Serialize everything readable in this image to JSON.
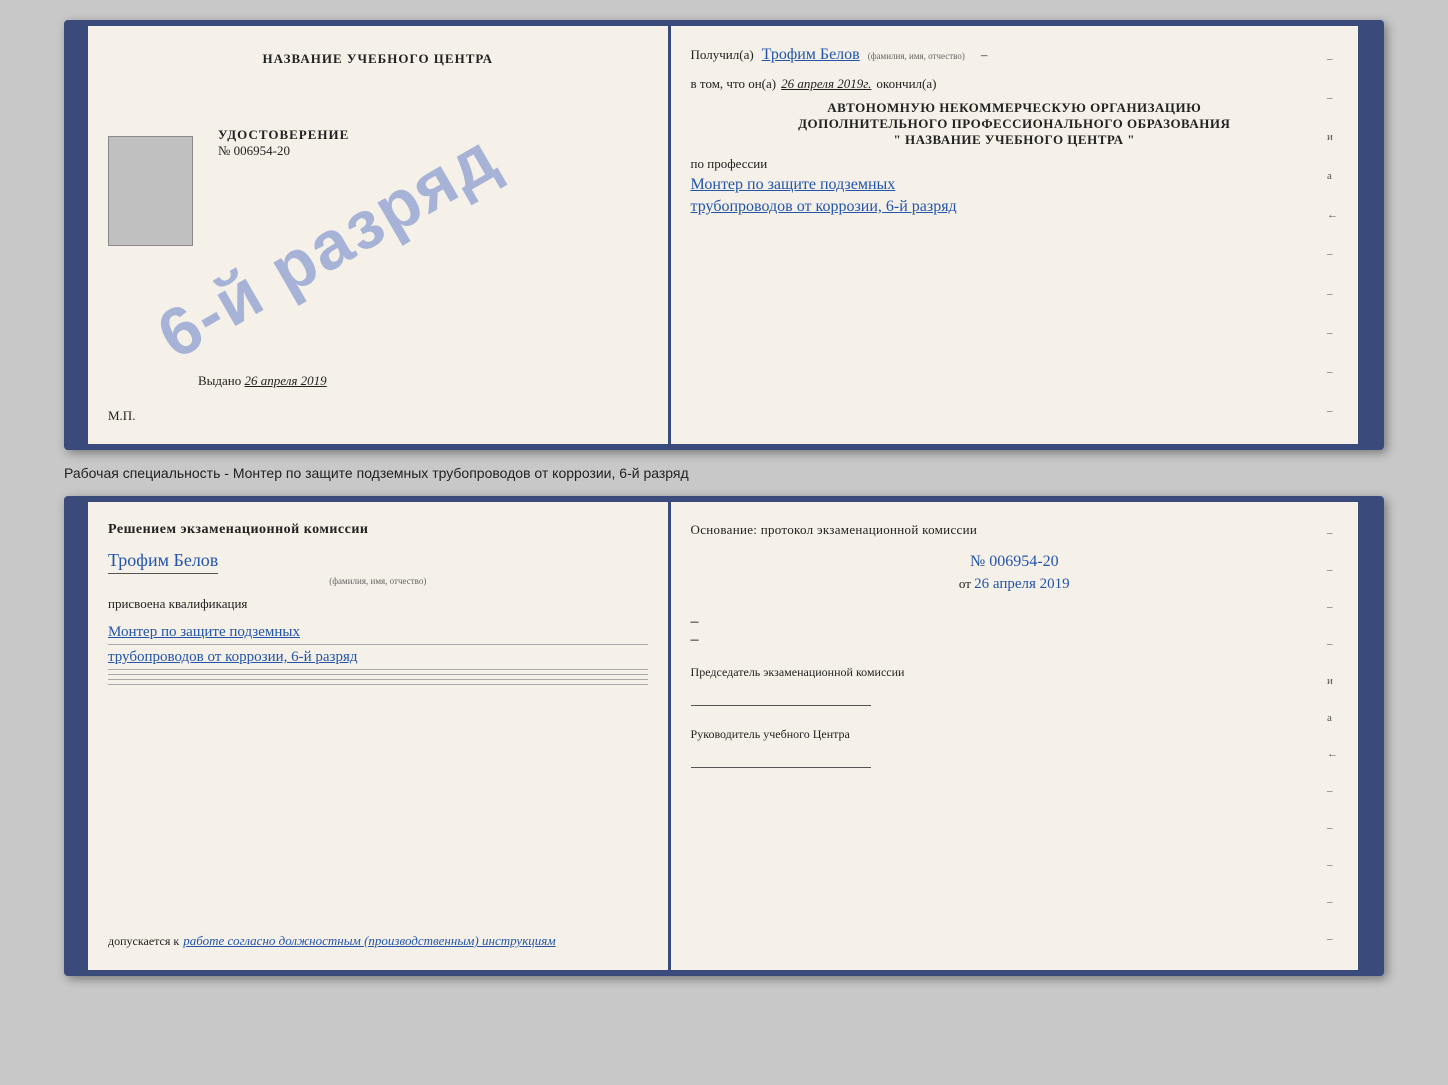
{
  "doc1": {
    "left": {
      "title": "НАЗВАНИЕ УЧЕБНОГО ЦЕНТРА",
      "udostoverenie_label": "УДОСТОВЕРЕНИЕ",
      "udostoverenie_number": "№ 006954-20",
      "vydano_label": "Выдано",
      "vydano_date": "26 апреля 2019",
      "mp": "М.П.",
      "stamp_text": "6-й разряд"
    },
    "right": {
      "received_label": "Получил(а)",
      "received_name": "Трофим Белов",
      "received_subtitle": "(фамилия, имя, отчество)",
      "dash1": "–",
      "vtom_label": "в том, что он(а)",
      "vtom_date": "26 апреля 2019г.",
      "okonchil": "окончил(а)",
      "org_line1": "АВТОНОМНУЮ НЕКОММЕРЧЕСКУЮ ОРГАНИЗАЦИЮ",
      "org_line2": "ДОПОЛНИТЕЛЬНОГО ПРОФЕССИОНАЛЬНОГО ОБРАЗОВАНИЯ",
      "org_line3": "\"  НАЗВАНИЕ УЧЕБНОГО ЦЕНТРА  \"",
      "po_professii": "по профессии",
      "profession_line1": "Монтер по защите подземных",
      "profession_line2": "трубопроводов от коррозии, 6-й разряд",
      "margin_letters": [
        "–",
        "–",
        "и",
        "а",
        "←",
        "–",
        "–",
        "–",
        "–",
        "–"
      ]
    }
  },
  "middle_text": "Рабочая специальность - Монтер по защите подземных трубопроводов от коррозии, 6-й разряд",
  "doc2": {
    "left": {
      "section_title": "Решением экзаменационной комиссии",
      "name": "Трофим Белов",
      "name_subtitle": "(фамилия, имя, отчество)",
      "prisvoena": "присвоена квалификация",
      "qualification_line1": "Монтер по защите подземных",
      "qualification_line2": "трубопроводов от коррозии, 6-й разряд",
      "blank_lines": [
        "",
        "",
        ""
      ],
      "dopuskaetsya_label": "допускается к",
      "dopuskaetsya_value": "работе согласно должностным (производственным) инструкциям"
    },
    "right": {
      "osnovaniye_label": "Основание: протокол экзаменационной комиссии",
      "protocol_number": "№ 006954-20",
      "ot_label": "от",
      "ot_date": "26 апреля 2019",
      "dash1": "–",
      "dash2": "–",
      "chairman_label": "Председатель экзаменационной комиссии",
      "rukovoditel_label": "Руководитель учебного Центра",
      "margin_letters": [
        "–",
        "–",
        "–",
        "–",
        "и",
        "а",
        "←",
        "–",
        "–",
        "–",
        "–",
        "–"
      ]
    }
  }
}
